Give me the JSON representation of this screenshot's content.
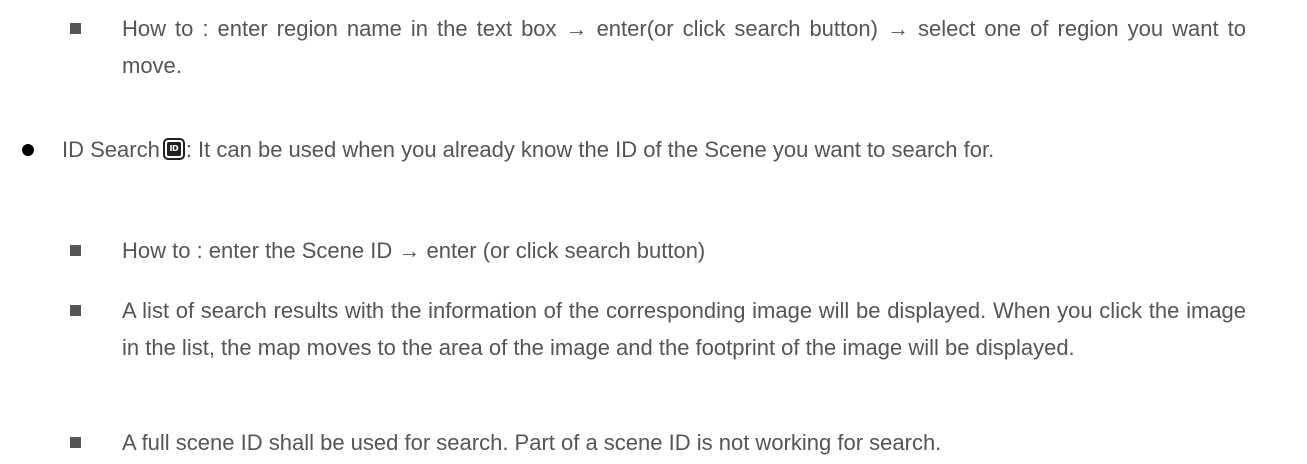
{
  "section_region": {
    "howto_text": "How to : enter region name in the text box → enter(or click search button) → select one of region you want to move."
  },
  "section_id": {
    "title": "ID Search",
    "icon_name": "id-search-icon",
    "icon_glyph": "ID",
    "description": ": It can be used when you already know the ID of the Scene you want to search for.",
    "items": [
      "How to : enter the Scene ID → enter (or click search button)",
      "A list of search results with the information of the corresponding image will be displayed. When you click the image in the list, the map moves to the area of the image and the footprint of the image will be displayed.",
      "A full scene ID shall be used for search. Part of a scene ID is not working for search."
    ]
  }
}
